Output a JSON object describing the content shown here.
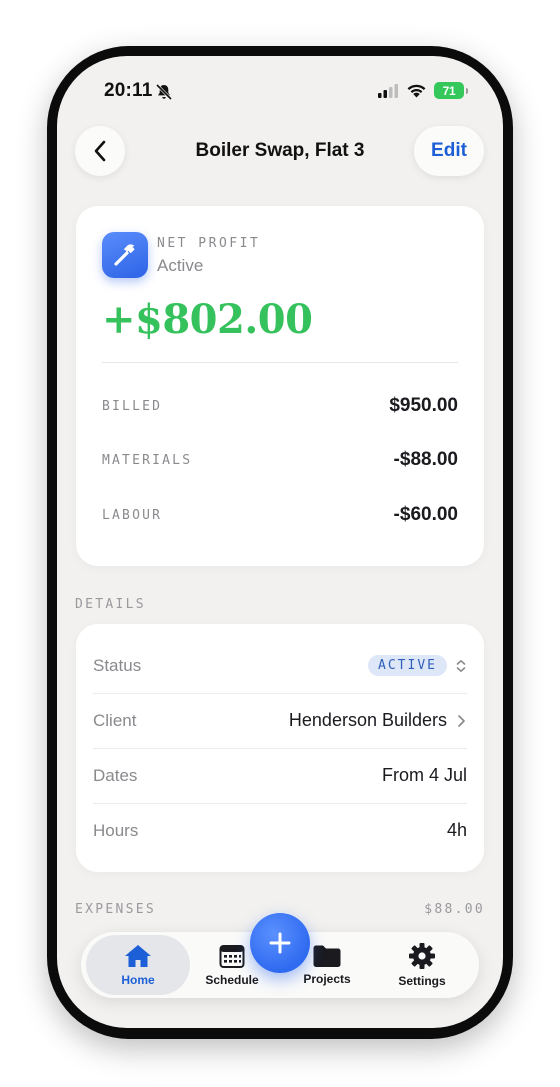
{
  "status_bar": {
    "time": "20:11",
    "battery": "71"
  },
  "nav": {
    "title": "Boiler Swap, Flat 3",
    "edit_label": "Edit"
  },
  "profit": {
    "label": "NET PROFIT",
    "status": "Active",
    "amount": "+$802.00",
    "amount_color": "#35c15c",
    "lines": [
      {
        "label": "BILLED",
        "value": "$950.00"
      },
      {
        "label": "MATERIALS",
        "value": "-$88.00"
      },
      {
        "label": "LABOUR",
        "value": "-$60.00"
      }
    ]
  },
  "details": {
    "section_label": "DETAILS",
    "status": {
      "label": "Status",
      "badge": "ACTIVE"
    },
    "client": {
      "label": "Client",
      "value": "Henderson Builders"
    },
    "dates": {
      "label": "Dates",
      "value": "From 4 Jul"
    },
    "hours": {
      "label": "Hours",
      "value": "4h"
    }
  },
  "expenses": {
    "section_label": "EXPENSES",
    "total": "$88.00"
  },
  "tabs": [
    {
      "label": "Home",
      "icon": "house-icon",
      "active": true
    },
    {
      "label": "Schedule",
      "icon": "calendar-icon",
      "active": false
    },
    {
      "label": "Projects",
      "icon": "folder-icon",
      "active": false
    },
    {
      "label": "Settings",
      "icon": "gear-icon",
      "active": false
    }
  ],
  "fab": {
    "icon": "plus-icon"
  },
  "colors": {
    "accent": "#1d5fd6",
    "profit": "#35c15c",
    "badge_bg": "#dde7f8"
  }
}
